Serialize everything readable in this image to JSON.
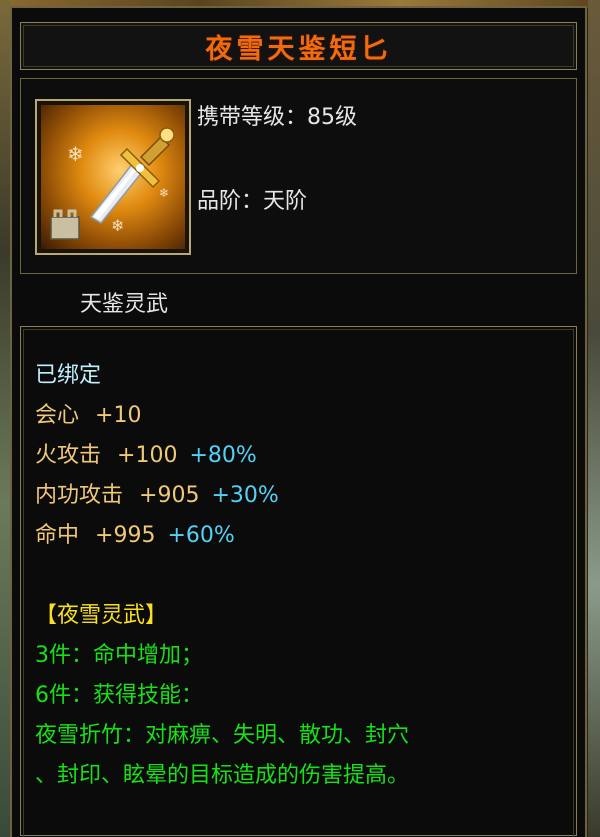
{
  "item": {
    "name": "夜雪天鉴短匕",
    "carry_level": "携带等级：85级",
    "grade": "品阶：天阶",
    "series": "天鉴灵武",
    "bound_status": "已绑定",
    "icon": "dagger-icon"
  },
  "stats": [
    {
      "name": "会心",
      "value": "+10",
      "percent": ""
    },
    {
      "name": "火攻击",
      "value": "+100",
      "percent": "+80%"
    },
    {
      "name": "内功攻击",
      "value": "+905",
      "percent": "+30%"
    },
    {
      "name": "命中",
      "value": "+995",
      "percent": "+60%"
    }
  ],
  "set": {
    "title": "【夜雪灵武】",
    "bonus_3": "3件：命中增加；",
    "bonus_6": "6件：获得技能：",
    "skill_line_1": "夜雪折竹：对麻痹、失明、散功、封穴",
    "skill_line_2": "、封印、眩晕的目标造成的伤害提高。"
  },
  "colors": {
    "title": "#f06a10",
    "stat": "#f0c878",
    "percent": "#55d0f5",
    "set_title": "#f8e020",
    "set_text": "#18e018"
  }
}
